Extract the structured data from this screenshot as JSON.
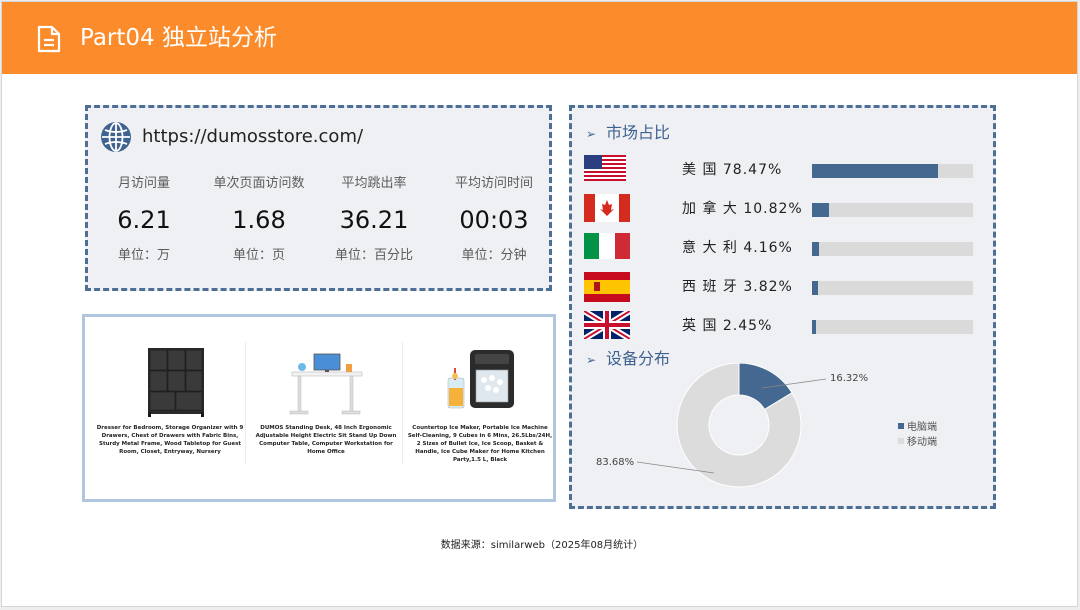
{
  "header": {
    "title": "Part04 独立站分析",
    "icon": "document-icon"
  },
  "site": {
    "url": "https://dumosstore.com/",
    "icon": "globe-icon",
    "stats": [
      {
        "label": "月访问量",
        "value": "6.21",
        "unit": "单位：万"
      },
      {
        "label": "单次页面访问数",
        "value": "1.68",
        "unit": "单位：页"
      },
      {
        "label": "平均跳出率",
        "value": "36.21",
        "unit": "单位：百分比"
      },
      {
        "label": "平均访问时间",
        "value": "00:03",
        "unit": "单位：分钟"
      }
    ]
  },
  "market": {
    "title": "市场占比",
    "rows": [
      {
        "name": "美   国  78.47%",
        "share": 0.7847,
        "flag": "us-flag-icon"
      },
      {
        "name": "加 拿 大  10.82%",
        "share": 0.1082,
        "flag": "canada-flag-icon"
      },
      {
        "name": "意 大 利  4.16%",
        "share": 0.0416,
        "flag": "italy-flag-icon"
      },
      {
        "name": "西 班 牙  3.82%",
        "share": 0.0382,
        "flag": "spain-flag-icon"
      },
      {
        "name": "英    国    2.45%",
        "share": 0.0245,
        "flag": "uk-flag-icon"
      }
    ],
    "bar_color": "#44688f",
    "track_color": "#dadada"
  },
  "device": {
    "title": "设备分布",
    "slices": [
      {
        "name": "电脑端",
        "value": 16.32,
        "label": "16.32%",
        "color": "#44688f"
      },
      {
        "name": "移动端",
        "value": 83.68,
        "label": "83.68%",
        "color": "#dcdcdc"
      }
    ]
  },
  "products": [
    {
      "description": "Dresser for Bedroom, Storage Organizer with 9 Drawers, Chest of Drawers with Fabric Bins, Sturdy Metal Frame, Wood Tabletop for Guest Room, Closet, Entryway, Nursery",
      "image": "dresser-image"
    },
    {
      "description": "DUMOS Standing Desk, 48 Inch Ergonomic Adjustable Height Electric Sit Stand Up Down Computer Table, Computer Workstation for Home Office",
      "image": "standing-desk-image"
    },
    {
      "description": "Countertop Ice Maker, Portable Ice Machine Self-Cleaning, 9 Cubes in 6 Mins, 26.5Lbs/24H, 2 Sizes of Bullet Ice, Ice Scoop, Basket & Handle, Ice Cube Maker for Home Kitchen Party,1.5 L, Black",
      "image": "ice-maker-image"
    }
  ],
  "footer": {
    "source": "数据来源：similarweb（2025年08月统计）"
  },
  "colors": {
    "header": "#fc8c2b",
    "accent": "#3f6290",
    "card_bg": "#eef0f4"
  }
}
